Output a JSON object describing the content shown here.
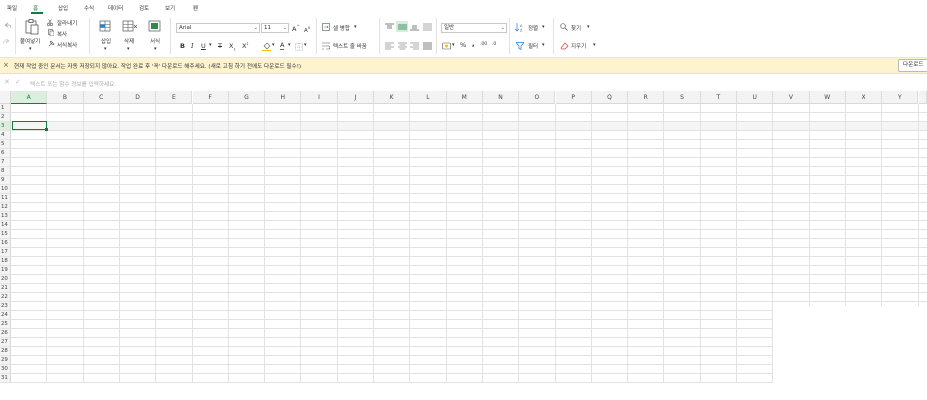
{
  "menu": {
    "items": [
      "파일",
      "홈",
      "삽입",
      "수식",
      "데이터",
      "검토",
      "보기",
      "펜"
    ],
    "active": "홈"
  },
  "ribbon": {
    "paste": "붙여넣기",
    "cut": "잘라내기",
    "copy": "복사",
    "format_painter": "서식복사",
    "insert": "삽입",
    "delete": "삭제",
    "format": "서식",
    "font_name": "Arial",
    "font_size": "11",
    "merge": "셀 병합",
    "wrap_text": "텍스트 줄 바꿈",
    "number_format": "일반",
    "sort": "정렬",
    "filter": "필터",
    "find": "찾기",
    "clear": "지우기"
  },
  "warning": {
    "message": "현재 작업 중인 문서는 자동 저장되지 않아요. 작업 완료 후 '꼭' 다운로드 해주세요. (새로 고침 하기 전에도 다운로드 필수!)",
    "button": "다운로드"
  },
  "formula_bar": {
    "placeholder": "텍스트 또는 함수 정보를 입력하세요."
  },
  "sheet": {
    "columns": [
      "A",
      "B",
      "C",
      "D",
      "E",
      "F",
      "G",
      "H",
      "I",
      "J",
      "K",
      "L",
      "M",
      "N",
      "O",
      "P",
      "Q",
      "R",
      "S",
      "T",
      "U",
      "V",
      "W",
      "X",
      "Y"
    ],
    "rows": [
      "1",
      "2",
      "3",
      "4",
      "5",
      "6",
      "7",
      "8",
      "9",
      "10",
      "11",
      "12",
      "13",
      "14",
      "15",
      "16",
      "17",
      "18",
      "19",
      "20",
      "21",
      "22",
      "23",
      "24",
      "25",
      "26",
      "27",
      "28",
      "29",
      "30",
      "31"
    ],
    "selected_column": "A",
    "selected_row": "3"
  },
  "colors": {
    "accent": "#107c41",
    "warning_bg": "#fdf3cf"
  },
  "icons": [
    "undo-icon",
    "redo-icon",
    "paste-icon",
    "cut-icon",
    "copy-icon",
    "format-painter-icon",
    "insert-cells-icon",
    "delete-cells-icon",
    "format-cells-icon",
    "increase-font-icon",
    "decrease-font-icon",
    "bold-icon",
    "italic-icon",
    "underline-icon",
    "strikethrough-icon",
    "subscript-icon",
    "superscript-icon",
    "fill-color-icon",
    "font-color-icon",
    "borders-icon",
    "merge-icon",
    "wrap-text-icon",
    "align-top-icon",
    "align-middle-icon",
    "align-bottom-icon",
    "justify-icon",
    "align-left-icon",
    "align-center-icon",
    "align-right-icon",
    "distributed-icon",
    "currency-icon",
    "percent-icon",
    "comma-icon",
    "increase-decimal-icon",
    "decrease-decimal-icon",
    "sort-icon",
    "filter-icon",
    "search-icon",
    "eraser-icon",
    "close-icon",
    "check-icon"
  ]
}
